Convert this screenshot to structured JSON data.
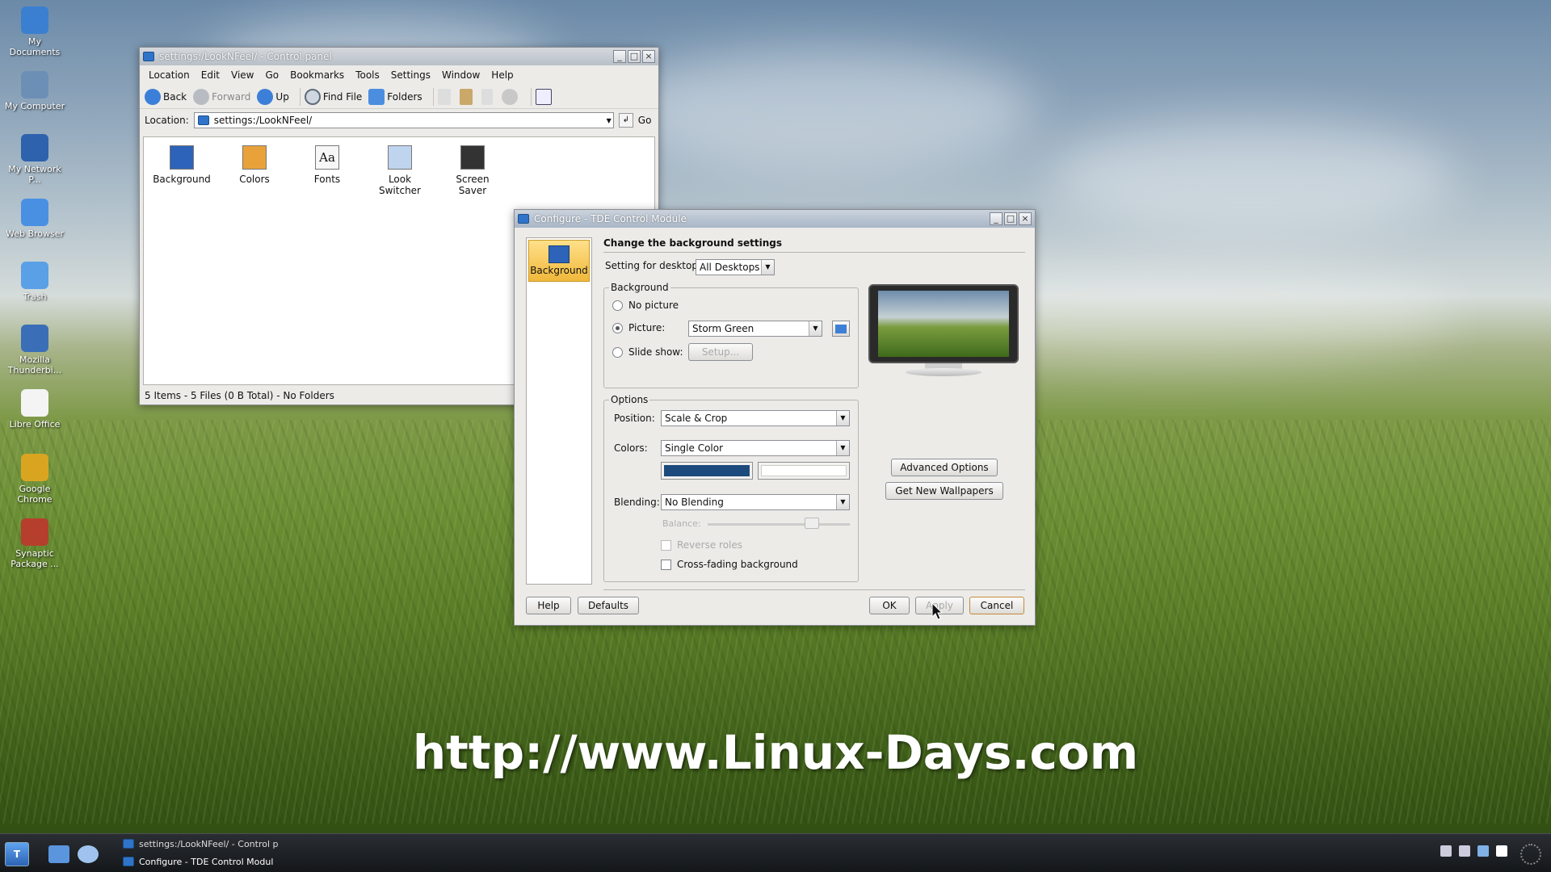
{
  "desktop": {
    "icons": [
      {
        "label": "My Documents",
        "color": "#3b7fd0"
      },
      {
        "label": "My Computer",
        "color": "#6c8fb5"
      },
      {
        "label": "My Network P...",
        "color": "#2f62ad"
      },
      {
        "label": "Web Browser",
        "color": "#4a90e2"
      },
      {
        "label": "Trash",
        "color": "#5aa0e6"
      },
      {
        "label": "Mozilla Thunderbi...",
        "color": "#3a6fb8"
      },
      {
        "label": "Libre Office",
        "color": "#f4f4f4"
      },
      {
        "label": "Google Chrome",
        "color": "#d9a521"
      },
      {
        "label": "Synaptic Package ...",
        "color": "#b53f2c"
      }
    ],
    "watermark": "http://www.Linux-Days.com"
  },
  "filemanager": {
    "title": "settings:/LookNFeel/ - Control panel",
    "menu": [
      "Location",
      "Edit",
      "View",
      "Go",
      "Bookmarks",
      "Tools",
      "Settings",
      "Window",
      "Help"
    ],
    "toolbar": {
      "back": "Back",
      "forward": "Forward",
      "up": "Up",
      "find": "Find File",
      "folders": "Folders"
    },
    "location_label": "Location:",
    "location_value": "settings:/LookNFeel/",
    "go": "Go",
    "items": [
      {
        "label": "Background",
        "icon": "background-icon"
      },
      {
        "label": "Colors",
        "icon": "colors-icon"
      },
      {
        "label": "Fonts",
        "icon": "fonts-icon",
        "glyph": "Aa"
      },
      {
        "label": "Look Switcher",
        "icon": "look-switcher-icon"
      },
      {
        "label": "Screen Saver",
        "icon": "screen-saver-icon"
      }
    ],
    "status": "5 Items - 5 Files (0 B Total) - No Folders"
  },
  "dialog": {
    "title": "Configure - TDE Control Module",
    "module_label": "Background",
    "heading": "Change the background settings",
    "setting_for": "Setting for desktop:",
    "desktop_value": "All Desktops",
    "background_group": "Background",
    "no_picture": "No picture",
    "picture": "Picture:",
    "picture_value": "Storm Green",
    "slideshow": "Slide show:",
    "setup": "Setup...",
    "options_group": "Options",
    "position": "Position:",
    "position_value": "Scale & Crop",
    "colors": "Colors:",
    "colors_value": "Single Color",
    "color1": "#1d4a7c",
    "blending": "Blending:",
    "blending_value": "No Blending",
    "balance": "Balance:",
    "reverse": "Reverse roles",
    "crossfade": "Cross-fading background",
    "advanced": "Advanced Options",
    "get_new": "Get New Wallpapers",
    "help": "Help",
    "defaults": "Defaults",
    "ok": "OK",
    "apply": "Apply",
    "cancel": "Cancel"
  },
  "taskbar": {
    "tasks": [
      "settings:/LookNFeel/ - Control p",
      "Configure - TDE Control Modul"
    ]
  }
}
